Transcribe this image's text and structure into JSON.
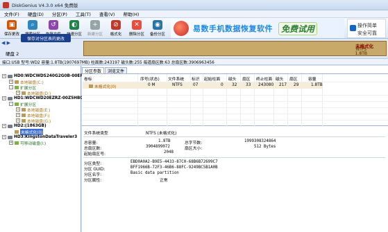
{
  "window": {
    "title": "DiskGenius V4.3.0 x64 免费版"
  },
  "menu": [
    "文件(F)",
    "硬盘(D)",
    "分区(P)",
    "工具(T)",
    "查看(V)",
    "帮助(H)"
  ],
  "toolbar": [
    {
      "label": "保存更改",
      "icon": "save-icon",
      "color": "#d35400"
    },
    {
      "label": "搜索分区",
      "icon": "search-icon",
      "color": "#2e86c1"
    },
    {
      "label": "恢复文件",
      "icon": "recover-icon",
      "color": "#8e44ad"
    },
    {
      "label": "快速分区",
      "icon": "quick-partition-icon",
      "color": "#1e8449"
    },
    {
      "label": "新建分区",
      "icon": "new-partition-icon",
      "color": "#7f8c8d"
    },
    {
      "label": "格式化",
      "icon": "format-icon",
      "color": "#c0392b"
    },
    {
      "label": "删除分区",
      "icon": "delete-icon",
      "color": "#e74c3c"
    },
    {
      "label": "备份分区",
      "icon": "backup-icon",
      "color": "#2874a6"
    }
  ],
  "ad": {
    "text": "易数手机数据恢复软件",
    "badge": "免费试用",
    "side_line1": "操作简单",
    "side_line2": "安全可靠"
  },
  "tooltip": "保存对分区表的更改",
  "disk_selector": {
    "label": "硬盘 2"
  },
  "disk_visual": {
    "part_name": "未格式化",
    "fs": "NTFS",
    "size": "1.8TB"
  },
  "infobar": "接口:USB  型号:WD2  容量:1.8TB(1907697MB)  柱面数:243197  磁头数:255  每道扇区数:63  总扇区数:3906963456",
  "tree": [
    {
      "text": "HD0:WDCWDS240G2G0B-00EP(2",
      "type": "disk",
      "indent": 0,
      "toggle": "-"
    },
    {
      "text": "本地磁盘(C:)",
      "type": "part",
      "indent": 1,
      "color": "orange",
      "toggle": "+"
    },
    {
      "text": "扩展分区",
      "type": "ext",
      "indent": 1,
      "color": "green",
      "toggle": "-"
    },
    {
      "text": "本地磁盘(D:)",
      "type": "part",
      "indent": 2,
      "color": "orange",
      "toggle": "+"
    },
    {
      "text": "HD1:WDCWD20EZRZ-00Z5HB0(1",
      "type": "disk",
      "indent": 0,
      "toggle": "-"
    },
    {
      "text": "扩展分区",
      "type": "ext",
      "indent": 1,
      "color": "green",
      "toggle": "-"
    },
    {
      "text": "本地磁盘(E:)",
      "type": "part",
      "indent": 2,
      "color": "orange",
      "toggle": "+"
    },
    {
      "text": "本地磁盘(F:)",
      "type": "part",
      "indent": 2,
      "color": "orange",
      "toggle": "+"
    },
    {
      "text": "本地磁盘(G:)",
      "type": "part",
      "indent": 2,
      "color": "orange",
      "toggle": "+"
    },
    {
      "text": "HD2:(1863GB)",
      "type": "disk",
      "indent": 0,
      "toggle": "-"
    },
    {
      "text": "未格式化(0)",
      "type": "part",
      "indent": 1,
      "color": "plain",
      "toggle": "",
      "selected": true
    },
    {
      "text": "HD3:KingstonDataTraveler3",
      "type": "disk",
      "indent": 0,
      "toggle": "-"
    },
    {
      "text": "可移动磁盘(I:)",
      "type": "part",
      "indent": 1,
      "color": "green",
      "toggle": "+"
    }
  ],
  "tabs": [
    "分区参数",
    "浏览文件"
  ],
  "grid": {
    "headers": [
      "卷标",
      "序号(状态)",
      "文件系统",
      "标识",
      "起始柱面",
      "磁头",
      "扇区",
      "终止柱面",
      "磁头",
      "扇区",
      "容量"
    ],
    "row": [
      "未格式化(0)",
      "0 M",
      "NTFS",
      "07",
      "0",
      "32",
      "33",
      "243080",
      "217",
      "29",
      "1.8TB"
    ]
  },
  "details": {
    "fs_type_label": "文件系统类型",
    "fs_type_value": "NTFS (未格式化)",
    "total_label": "总容量:",
    "total_value": "1.8TB",
    "total_bytes_label": "总字节数:",
    "total_bytes_value": "1999308324864",
    "total_sectors_label": "总扇区数:",
    "total_sectors_value": "3904899072",
    "sector_size_label": "扇区大小:",
    "sector_size_value": "512 Bytes",
    "start_sector_label": "起始扇区号:",
    "start_sector_value": "2048",
    "type_label": "分区类型:",
    "type_value": "EBD0A0A2-B9E5-4433-87C0-68B6B72699C7",
    "guid_label": "分区 GUID:",
    "guid_value": "BFF1966B-72F3-46B6-88FC-9249BC5B1A0B",
    "name_label": "分区名字:",
    "name_value": "Basic data partition",
    "attr_label": "分区属性:",
    "attr_value": "正常"
  }
}
